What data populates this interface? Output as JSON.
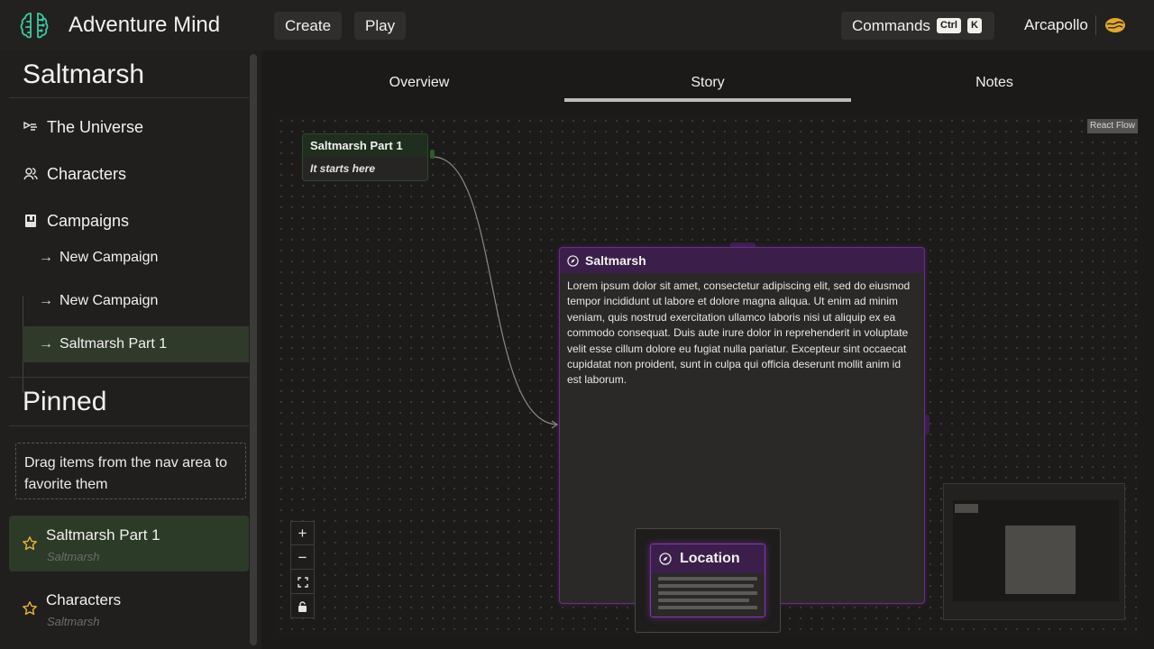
{
  "header": {
    "app_title": "Adventure Mind",
    "create_label": "Create",
    "play_label": "Play",
    "commands_label": "Commands",
    "kbd_ctrl": "Ctrl",
    "kbd_k": "K",
    "user_name": "Arcapollo"
  },
  "sidebar": {
    "title": "Saltmarsh",
    "items": [
      {
        "label": "The Universe",
        "icon": "universe-icon"
      },
      {
        "label": "Characters",
        "icon": "characters-icon"
      },
      {
        "label": "Campaigns",
        "icon": "book-icon"
      }
    ],
    "campaigns": [
      {
        "label": "New Campaign"
      },
      {
        "label": "New Campaign"
      },
      {
        "label": "Saltmarsh Part 1",
        "active": true
      }
    ],
    "pinned_title": "Pinned",
    "drag_hint": "Drag items from the nav area to favorite them",
    "pinned": [
      {
        "title": "Saltmarsh Part 1",
        "sub": "Saltmarsh",
        "active": true
      },
      {
        "title": "Characters",
        "sub": "Saltmarsh"
      }
    ]
  },
  "tabs": [
    {
      "label": "Overview"
    },
    {
      "label": "Story",
      "active": true
    },
    {
      "label": "Notes"
    }
  ],
  "flow": {
    "attribution": "React Flow",
    "node_part1": {
      "title": "Saltmarsh Part 1",
      "body": "It starts here"
    },
    "node_saltmarsh": {
      "title": "Saltmarsh",
      "body": "Lorem ipsum dolor sit amet, consectetur adipiscing elit, sed do eiusmod tempor incididunt ut labore et dolore magna aliqua. Ut enim ad minim veniam, quis nostrud exercitation ullamco laboris nisi ut aliquip ex ea commodo consequat. Duis aute irure dolor in reprehenderit in voluptate velit esse cillum dolore eu fugiat nulla pariatur. Excepteur sint occaecat cupidatat non proident, sunt in culpa qui officia deserunt mollit anim id est laborum."
    },
    "location_card": {
      "title": "Location"
    },
    "controls": {
      "zoom_in": "+",
      "zoom_out": "−"
    }
  },
  "colors": {
    "accent_green": "#2c3a28",
    "accent_purple": "#6b2e8a",
    "star": "#e8b43a"
  }
}
